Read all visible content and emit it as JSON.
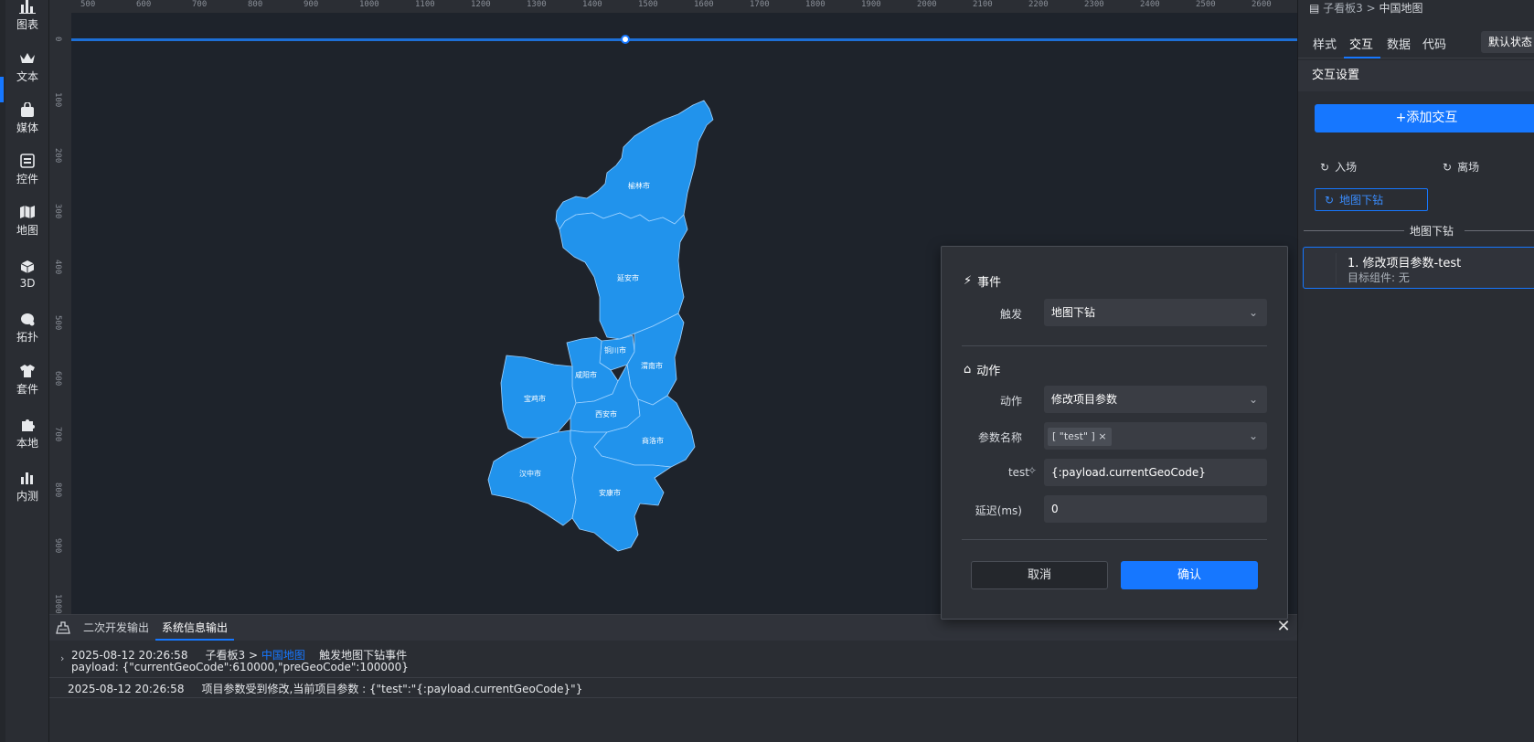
{
  "left_toolbar": {
    "items": [
      {
        "label": "图表",
        "icon": "bar-chart-icon"
      },
      {
        "label": "文本",
        "icon": "crown-text-icon"
      },
      {
        "label": "媒体",
        "icon": "media-bag-icon"
      },
      {
        "label": "控件",
        "icon": "form-control-icon"
      },
      {
        "label": "地图",
        "icon": "map-icon"
      },
      {
        "label": "3D",
        "icon": "cube-3d-icon"
      },
      {
        "label": "拓扑",
        "icon": "topology-icon"
      },
      {
        "label": "套件",
        "icon": "shirt-kit-icon"
      },
      {
        "label": "本地",
        "icon": "puzzle-icon"
      },
      {
        "label": "内测",
        "icon": "beta-chart-icon"
      }
    ]
  },
  "ruler": {
    "top_ticks": [
      "500",
      "600",
      "700",
      "800",
      "900",
      "1000",
      "1100",
      "1200",
      "1300",
      "1400",
      "1500",
      "1600",
      "1700",
      "1800",
      "1900",
      "2000",
      "2100",
      "2200",
      "2300",
      "2400",
      "2500",
      "2600"
    ],
    "left_ticks": [
      "0",
      "100",
      "200",
      "300",
      "400",
      "500",
      "600",
      "700",
      "800",
      "900",
      "1000"
    ]
  },
  "map": {
    "fill_color": "#2193ec",
    "regions": [
      "榆林市",
      "延安市",
      "铜川市",
      "渭南市",
      "咸阳市",
      "宝鸡市",
      "西安市",
      "商洛市",
      "汉中市",
      "安康市"
    ]
  },
  "console": {
    "tabs": [
      "二次开发输出",
      "系统信息输出"
    ],
    "active_tab": "系统信息输出",
    "log1": {
      "time": "2025-08-12 20:26:58",
      "source_prefix": "子看板3 >",
      "source_link": "中国地图",
      "message": "触发地图下钻事件",
      "payload": "payload: {\"currentGeoCode\":610000,\"preGeoCode\":100000}"
    },
    "log2": {
      "time": "2025-08-12 20:26:58",
      "message": "项目参数受到修改,当前项目参数 : {\"test\":\"{:payload.currentGeoCode}\"}"
    }
  },
  "right_panel": {
    "breadcrumb_parent": "子看板3",
    "breadcrumb_sep": ">",
    "breadcrumb_current": "中国地图",
    "tabs": [
      "样式",
      "交互",
      "数据",
      "代码"
    ],
    "active_tab": "交互",
    "state_button": "默认状态",
    "section_title": "交互设置",
    "add_button": "+添加交互",
    "triggers": [
      "入场",
      "离场",
      "地图下钻"
    ],
    "active_trigger": "地图下钻",
    "divider_label": "地图下钻",
    "card": {
      "title": "1. 修改项目参数-test",
      "subtitle": "目标组件: 无"
    }
  },
  "dialog": {
    "event_heading": "事件",
    "trigger_label": "触发",
    "trigger_value": "地图下钻",
    "action_heading": "动作",
    "action_label": "动作",
    "action_value": "修改项目参数",
    "param_label": "参数名称",
    "param_tag": "[ \"test\" ]",
    "test_label": "test",
    "test_value": "{:payload.currentGeoCode}",
    "delay_label": "延迟(ms)",
    "delay_value": "0",
    "cancel_label": "取消",
    "ok_label": "确认"
  }
}
